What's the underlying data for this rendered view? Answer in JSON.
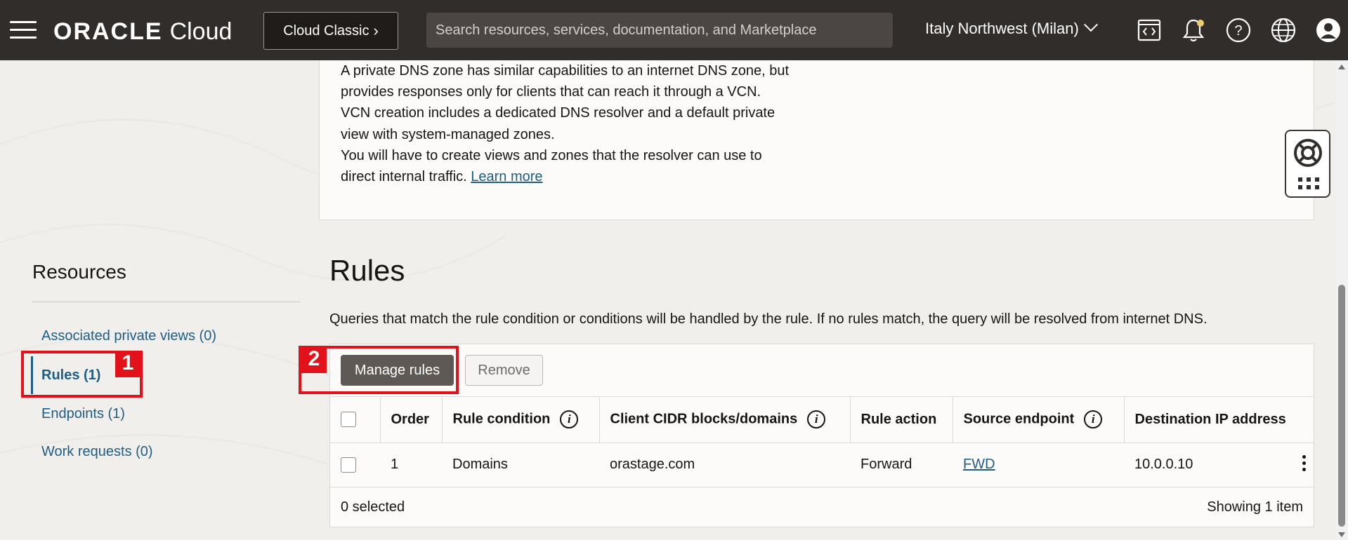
{
  "header": {
    "brand_oracle": "ORACLE",
    "brand_cloud": "Cloud",
    "classic_label": "Cloud Classic",
    "search_placeholder": "Search resources, services, documentation, and Marketplace",
    "region": "Italy Northwest (Milan)"
  },
  "info": {
    "lines": [
      "A private DNS zone has similar capabilities to an internet DNS zone, but",
      "provides responses only for clients that can reach it through a VCN.",
      "VCN creation includes a dedicated DNS resolver and a default private",
      "view with system-managed zones.",
      "You will have to create views and zones that the resolver can use to"
    ],
    "last_line_prefix": "direct internal traffic.",
    "learn_more": "Learn more"
  },
  "resources": {
    "title": "Resources",
    "items": [
      {
        "label": "Associated private views (0)",
        "active": false
      },
      {
        "label": "Rules (1)",
        "active": true
      },
      {
        "label": "Endpoints (1)",
        "active": false
      },
      {
        "label": "Work requests (0)",
        "active": false
      }
    ]
  },
  "annotations": {
    "badge_1": "1",
    "badge_2": "2",
    "color": "#e2111a"
  },
  "rules": {
    "title": "Rules",
    "description": "Queries that match the rule condition or conditions will be handled by the rule. If no rules match, the query will be resolved from internet DNS.",
    "manage_label": "Manage rules",
    "remove_label": "Remove",
    "columns": [
      "Order",
      "Rule condition",
      "Client CIDR blocks/domains",
      "Rule action",
      "Source endpoint",
      "Destination IP address"
    ],
    "rows": [
      {
        "order": "1",
        "condition": "Domains",
        "client": "orastage.com",
        "action": "Forward",
        "source": "FWD",
        "destination": "10.0.0.10"
      }
    ],
    "selected_text": "0 selected",
    "showing_text": "Showing 1 item"
  },
  "colors": {
    "topbar": "#312d2a",
    "link": "#1f5e84",
    "primary_button": "#5e5955"
  }
}
